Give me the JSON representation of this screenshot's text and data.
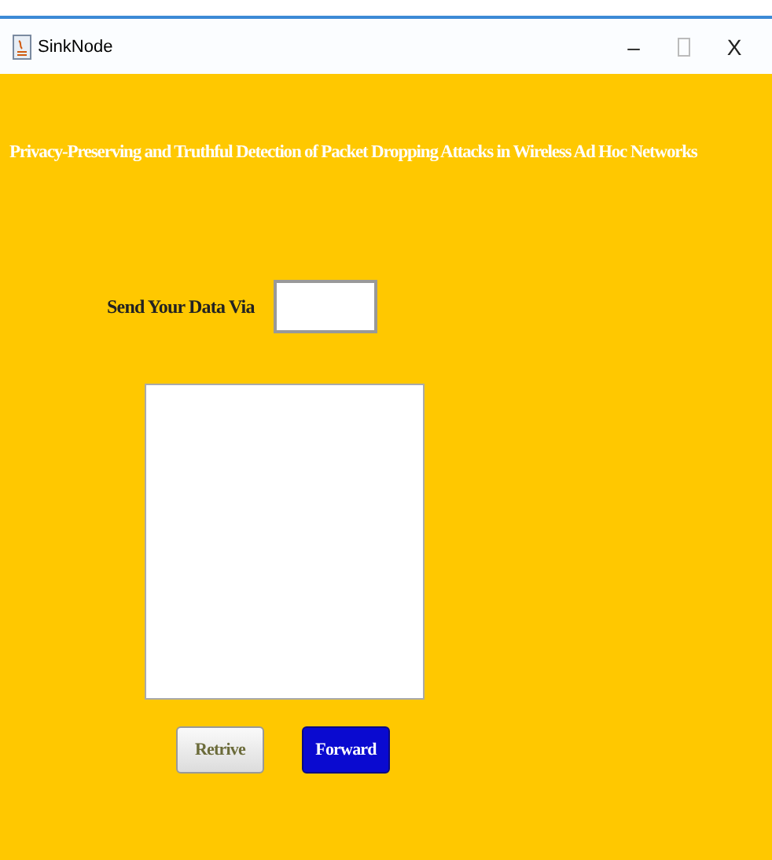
{
  "window": {
    "title": "SinkNode",
    "controls": [
      "–",
      "X"
    ]
  },
  "heading": "Privacy-Preserving and Truthful Detection of Packet Dropping Attacks in Wireless Ad Hoc Networks",
  "send_label": "Send Your Data Via",
  "buttons": [
    {
      "label": "Retrive",
      "kind": "secondary"
    },
    {
      "label": "Forward",
      "kind": "primary"
    }
  ]
}
